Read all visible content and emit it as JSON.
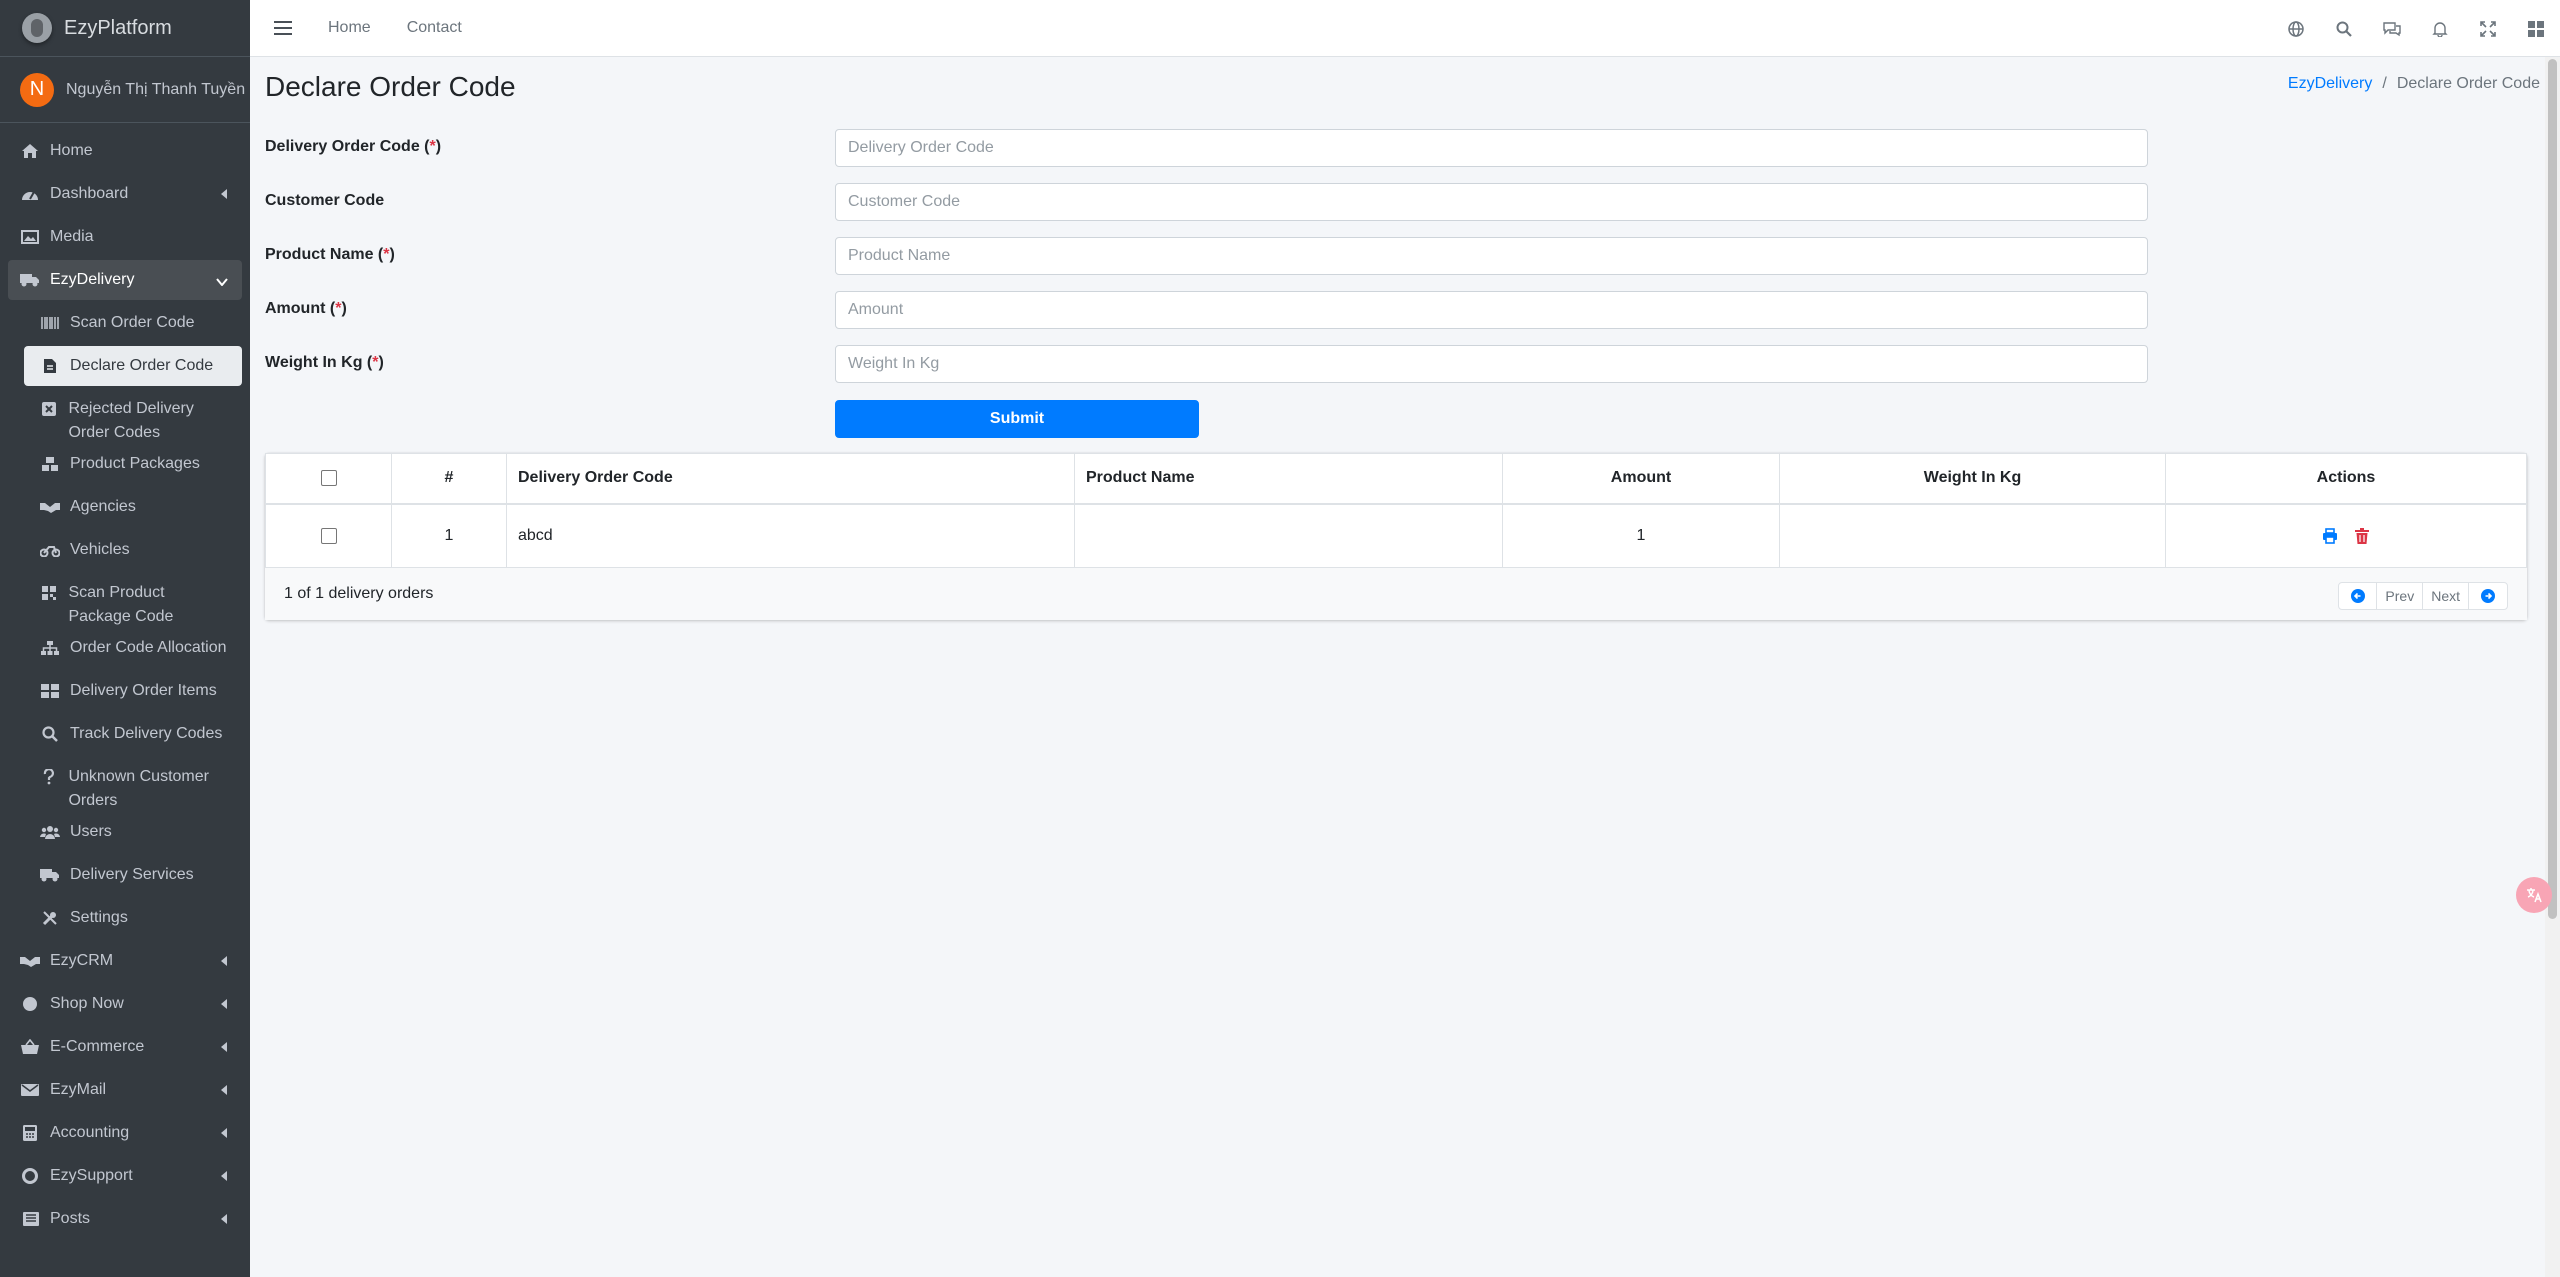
{
  "app": {
    "brand": "EzyPlatform",
    "user_initial": "N",
    "user_name": "Nguyễn Thị Thanh Tuyền"
  },
  "sidebar": {
    "items": [
      {
        "label": "Home",
        "icon": "home-icon"
      },
      {
        "label": "Dashboard",
        "icon": "dashboard-icon"
      },
      {
        "label": "Media",
        "icon": "image-icon"
      },
      {
        "label": "EzyDelivery",
        "icon": "truck-icon"
      },
      {
        "label": "EzyCRM",
        "icon": "handshake-icon"
      },
      {
        "label": "Shop Now",
        "icon": "circle-icon"
      },
      {
        "label": "E-Commerce",
        "icon": "basket-icon"
      },
      {
        "label": "EzyMail",
        "icon": "envelope-icon"
      },
      {
        "label": "Accounting",
        "icon": "calculator-icon"
      },
      {
        "label": "EzySupport",
        "icon": "lifebuoy-icon"
      },
      {
        "label": "Posts",
        "icon": "newspaper-icon"
      }
    ],
    "sub_items": [
      {
        "label": "Scan Order Code",
        "icon": "barcode-icon"
      },
      {
        "label": "Declare Order Code",
        "icon": "file-icon"
      },
      {
        "label": "Rejected Delivery Order Codes",
        "icon": "x-square-icon"
      },
      {
        "label": "Product Packages",
        "icon": "cubes-icon"
      },
      {
        "label": "Agencies",
        "icon": "handshake-icon"
      },
      {
        "label": "Vehicles",
        "icon": "motorcycle-icon"
      },
      {
        "label": "Scan Product Package Code",
        "icon": "qrcode-icon"
      },
      {
        "label": "Order Code Allocation",
        "icon": "sitemap-icon"
      },
      {
        "label": "Delivery Order Items",
        "icon": "grid-icon"
      },
      {
        "label": "Track Delivery Codes",
        "icon": "search-icon"
      },
      {
        "label": "Unknown Customer Orders",
        "icon": "question-icon"
      },
      {
        "label": "Users",
        "icon": "users-icon"
      },
      {
        "label": "Delivery Services",
        "icon": "truck-icon"
      },
      {
        "label": "Settings",
        "icon": "tools-icon"
      }
    ]
  },
  "topnav": {
    "links": [
      "Home",
      "Contact"
    ],
    "icons": [
      "globe-icon",
      "search-icon",
      "comments-icon",
      "bell-icon",
      "expand-icon",
      "apps-icon"
    ]
  },
  "page": {
    "title": "Declare Order Code",
    "breadcrumb": [
      "EzyDelivery",
      "Declare Order Code"
    ]
  },
  "form": {
    "required_mark": "*",
    "fields": [
      {
        "label": "Delivery Order Code",
        "required": true,
        "placeholder": "Delivery Order Code"
      },
      {
        "label": "Customer Code",
        "required": false,
        "placeholder": "Customer Code"
      },
      {
        "label": "Product Name",
        "required": true,
        "placeholder": "Product Name"
      },
      {
        "label": "Amount",
        "required": true,
        "placeholder": "Amount"
      },
      {
        "label": "Weight In Kg",
        "required": true,
        "placeholder": "Weight In Kg"
      }
    ],
    "submit_label": "Submit"
  },
  "table": {
    "headers": [
      "#",
      "Delivery Order Code",
      "Product Name",
      "Amount",
      "Weight In Kg",
      "Actions"
    ],
    "rows": [
      {
        "index": "1",
        "code": "abcd",
        "product_name": "",
        "amount": "1",
        "weight": ""
      }
    ],
    "summary": "1 of 1 delivery orders",
    "pager": {
      "prev": "Prev",
      "next": "Next"
    }
  },
  "colors": {
    "primary": "#007bff",
    "danger": "#dc3545",
    "sidebar": "#343a40",
    "avatar": "#f46b12"
  }
}
